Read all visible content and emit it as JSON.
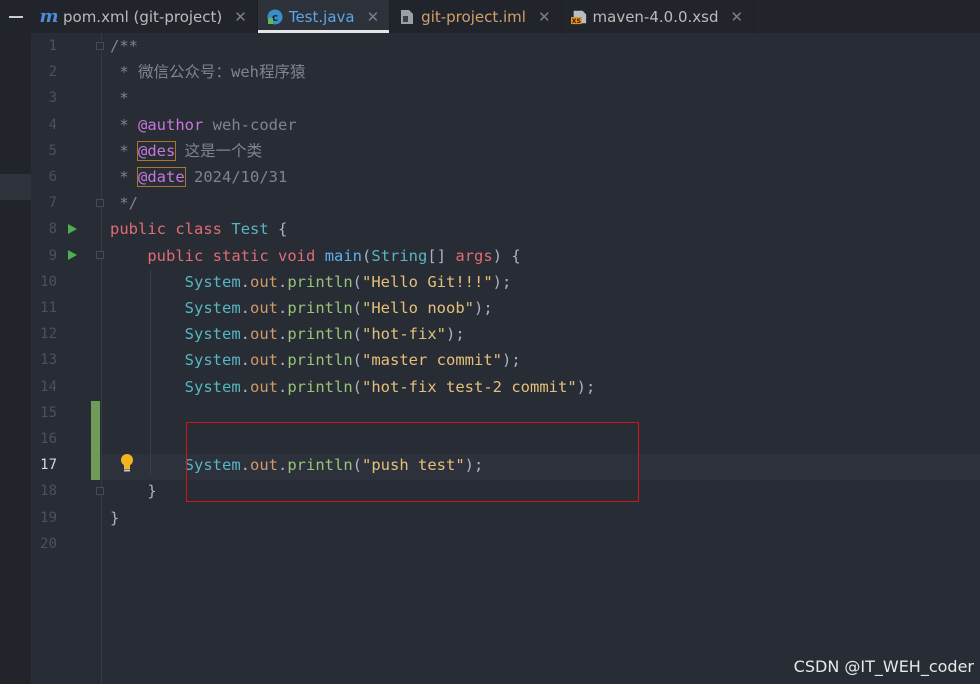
{
  "tabs": [
    {
      "label": "pom.xml (git-project)",
      "icon": "maven-m-icon"
    },
    {
      "label": "Test.java",
      "icon": "java-class-icon",
      "active": true
    },
    {
      "label": "git-project.iml",
      "icon": "module-file-icon"
    },
    {
      "label": "maven-4.0.0.xsd",
      "icon": "xsd-file-icon"
    }
  ],
  "close_glyph": "✕",
  "line_numbers": [
    "1",
    "2",
    "3",
    "4",
    "5",
    "6",
    "7",
    "8",
    "9",
    "10",
    "11",
    "12",
    "13",
    "14",
    "15",
    "16",
    "17",
    "18",
    "19",
    "20"
  ],
  "current_line": "17",
  "code": {
    "l1": "/**",
    "l2": " * 微信公众号：weh程序猿",
    "l3": " *",
    "l4_prefix": " * ",
    "l4_tag": "@author",
    "l4_text": " weh-coder",
    "l5_prefix": " * ",
    "l5_tag": "@des",
    "l5_text": " 这是一个类",
    "l6_prefix": " * ",
    "l6_tag": "@date",
    "l6_text": " 2024/10/31",
    "l7": " */",
    "public": "public",
    "class": "class",
    "class_name": "Test",
    "open_brace": " {",
    "static": "static",
    "void": "void",
    "main": "main",
    "string_type": "String",
    "args": "args",
    "system": "System",
    "out": "out",
    "println": "println",
    "s10": "\"Hello Git!!!\"",
    "s11": "\"Hello noob\"",
    "s12": "\"hot-fix\"",
    "s13": "\"master commit\"",
    "s14": "\"hot-fix test-2 commit\"",
    "s17": "\"push test\"",
    "close_brace": "}"
  },
  "watermark": "CSDN @IT_WEH_coder",
  "colors": {
    "keyword": "#e06c75",
    "string": "#e5c07b",
    "method": "#98c379",
    "type": "#56b6c2",
    "highlight_box": "#d0161a"
  }
}
